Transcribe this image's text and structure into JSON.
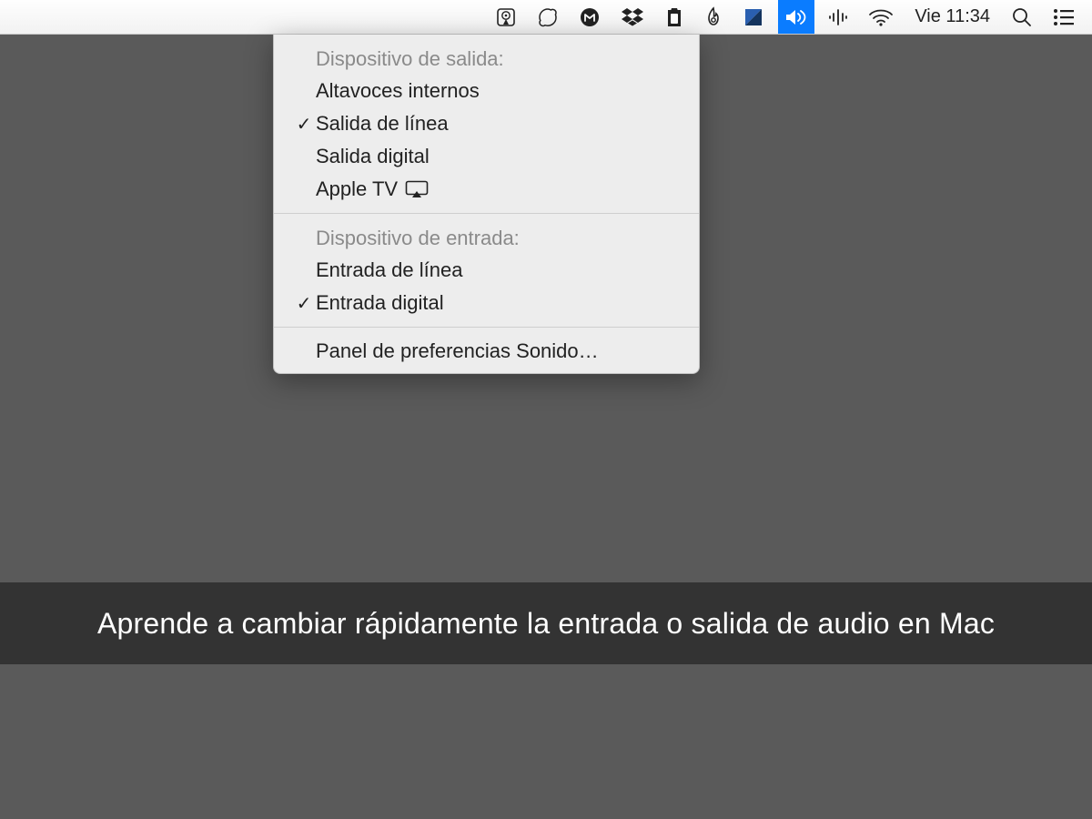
{
  "menubar": {
    "clock": "Vie 11:34"
  },
  "dropdown": {
    "output_header": "Dispositivo de salida:",
    "output_items": [
      {
        "label": "Altavoces internos",
        "checked": false,
        "airplay": false
      },
      {
        "label": "Salida de línea",
        "checked": true,
        "airplay": false
      },
      {
        "label": "Salida digital",
        "checked": false,
        "airplay": false
      },
      {
        "label": "Apple TV",
        "checked": false,
        "airplay": true
      }
    ],
    "input_header": "Dispositivo de entrada:",
    "input_items": [
      {
        "label": "Entrada de línea",
        "checked": false
      },
      {
        "label": "Entrada digital",
        "checked": true
      }
    ],
    "prefs_label": "Panel de preferencias Sonido…"
  },
  "caption": "Aprende a cambiar rápidamente la entrada o salida de audio en Mac"
}
